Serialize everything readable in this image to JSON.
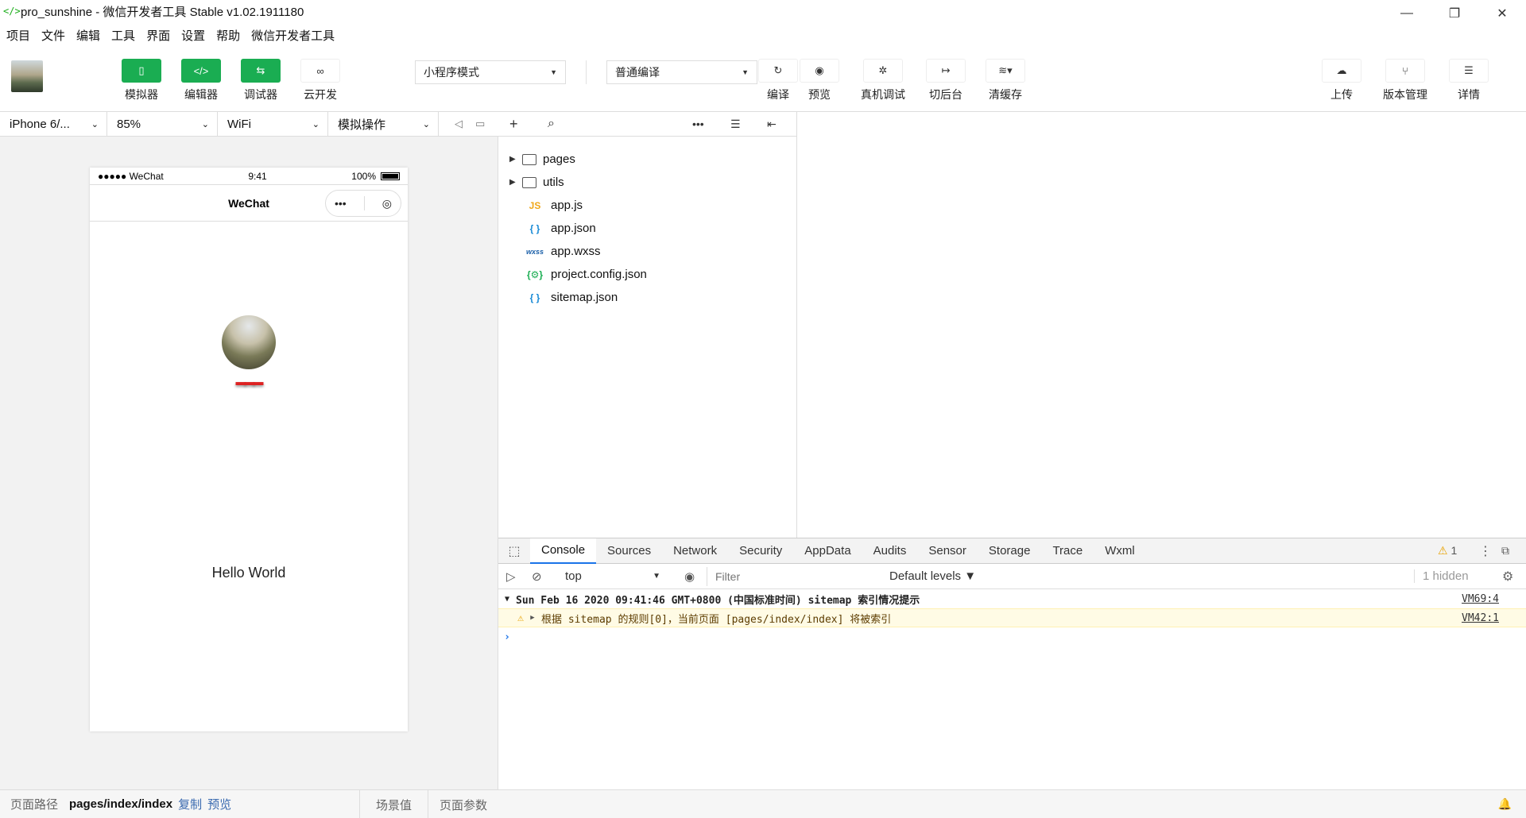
{
  "window": {
    "title": "pro_sunshine - 微信开发者工具 Stable v1.02.1911180",
    "logo": "</>",
    "minimize": "—",
    "restore": "❐",
    "close": "✕"
  },
  "menu": [
    "项目",
    "文件",
    "编辑",
    "工具",
    "界面",
    "设置",
    "帮助",
    "微信开发者工具"
  ],
  "toolbar": {
    "left_buttons": [
      {
        "label": "模拟器",
        "icon": "phone-icon",
        "glyph": "▯"
      },
      {
        "label": "编辑器",
        "icon": "code-icon",
        "glyph": "</>"
      },
      {
        "label": "调试器",
        "icon": "debug-sliders-icon",
        "glyph": "⇆"
      },
      {
        "label": "云开发",
        "icon": "cloud-link-icon",
        "glyph": "∞"
      }
    ],
    "mode_select": "小程序模式",
    "compile_select": "普通编译",
    "center_buttons": [
      {
        "label": "编译",
        "icon": "refresh-icon",
        "glyph": "↻"
      },
      {
        "label": "预览",
        "icon": "eye-icon",
        "glyph": "◉"
      },
      {
        "label": "真机调试",
        "icon": "bug-icon",
        "glyph": "✲"
      },
      {
        "label": "切后台",
        "icon": "switch-background-icon",
        "glyph": "↦"
      },
      {
        "label": "清缓存",
        "icon": "layers-icon",
        "glyph": "≋▾"
      }
    ],
    "right_buttons": [
      {
        "label": "上传",
        "icon": "cloud-upload-icon",
        "glyph": "☁"
      },
      {
        "label": "版本管理",
        "icon": "branch-icon",
        "glyph": "⑂"
      },
      {
        "label": "详情",
        "icon": "menu-lines-icon",
        "glyph": "☰"
      }
    ]
  },
  "simulator": {
    "device": "iPhone 6/...",
    "zoom": "85%",
    "network": "WiFi",
    "operation": "模拟操作",
    "status_left": "●●●●● WeChat",
    "status_time": "9:41",
    "status_battery": "100%",
    "nav_title": "WeChat",
    "capsule_more": "•••",
    "capsule_close": "◎",
    "nickname": "▬▬▬",
    "hello": "Hello World"
  },
  "path_bar": {
    "label": "页面路径",
    "path": "pages/index/index",
    "copy": "复制",
    "preview": "预览",
    "scene": "场景值",
    "params": "页面参数"
  },
  "file_tree": {
    "folders": [
      "pages",
      "utils"
    ],
    "files": [
      {
        "name": "app.js",
        "type": "JS",
        "color": "#f0a81a"
      },
      {
        "name": "app.json",
        "type": "{ }",
        "color": "#1a8bd6"
      },
      {
        "name": "app.wxss",
        "type": "wxss",
        "color": "#1a5fa8"
      },
      {
        "name": "project.config.json",
        "type": "{⚙}",
        "color": "#1aad52"
      },
      {
        "name": "sitemap.json",
        "type": "{ }",
        "color": "#1a8bd6"
      }
    ]
  },
  "devtools": {
    "tabs": [
      "Console",
      "Sources",
      "Network",
      "Security",
      "AppData",
      "Audits",
      "Sensor",
      "Storage",
      "Trace",
      "Wxml"
    ],
    "active_tab": "Console",
    "warning_count": "1",
    "context": "top",
    "filter_placeholder": "Filter",
    "levels": "Default levels ▼",
    "hidden": "1 hidden",
    "logs": [
      {
        "text": "Sun Feb 16 2020 09:41:46 GMT+0800 (中国标准时间) sitemap 索引情况提示",
        "source": "VM69:4",
        "level": "group"
      },
      {
        "text": "根据 sitemap 的规则[0]，当前页面 [pages/index/index] 将被索引",
        "source": "VM42:1",
        "level": "warn"
      }
    ],
    "prompt": "›"
  },
  "colors": {
    "accent_green": "#1aad52",
    "link_blue": "#3a6ab0",
    "warn_bg": "#fffbe5",
    "tab_active": "#1a73e8"
  }
}
